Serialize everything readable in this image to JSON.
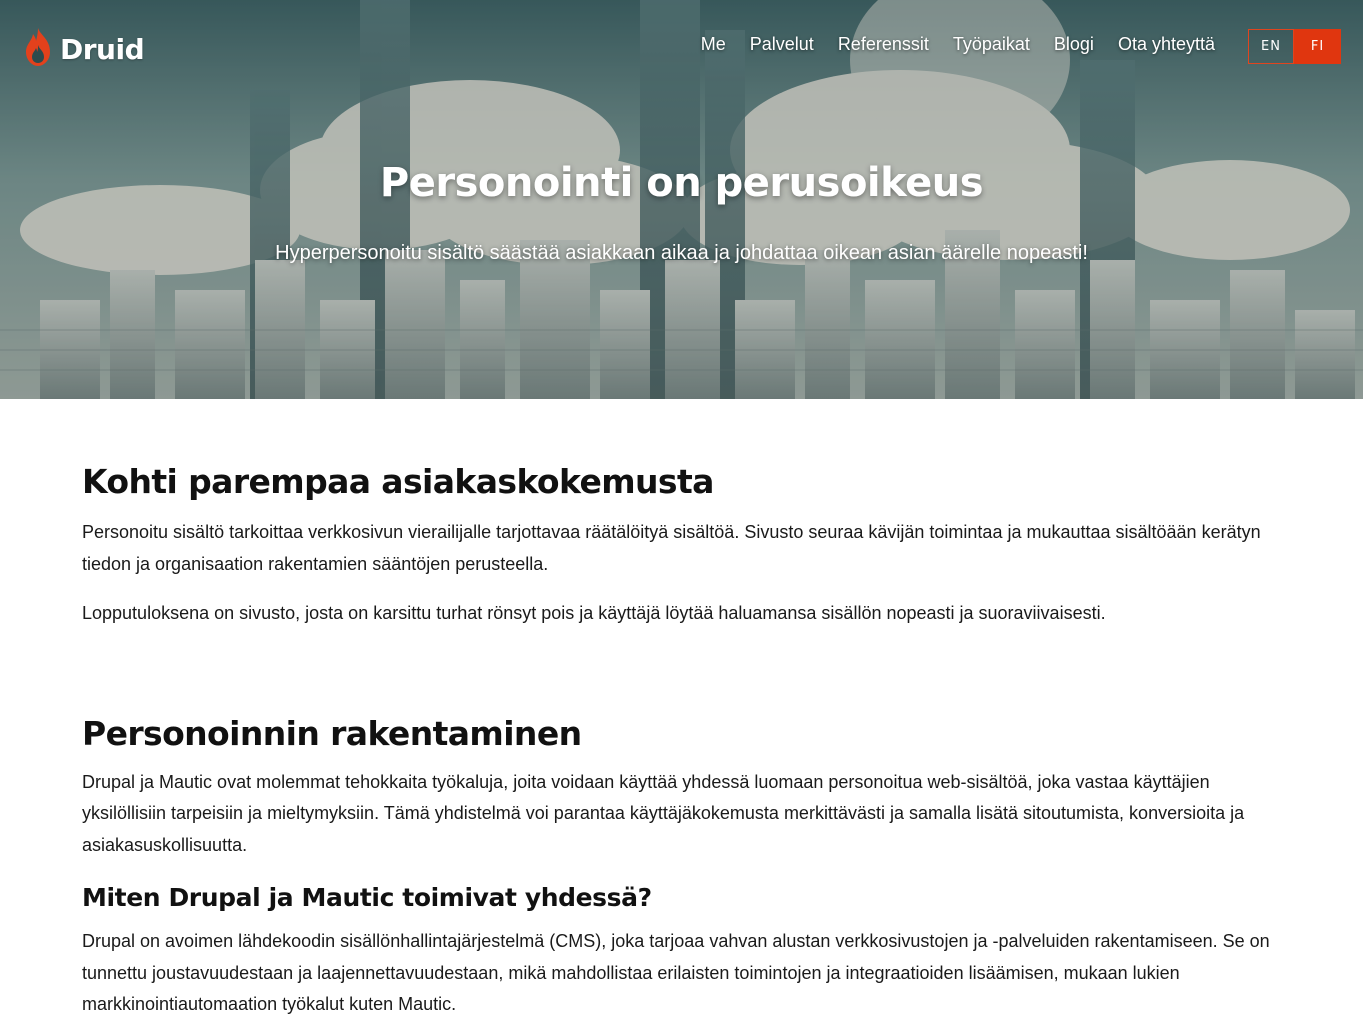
{
  "brand": {
    "name": "Druid",
    "accent": "#e0360f"
  },
  "nav": {
    "items": [
      {
        "label": "Me"
      },
      {
        "label": "Palvelut"
      },
      {
        "label": "Referenssit"
      },
      {
        "label": "Työpaikat"
      },
      {
        "label": "Blogi"
      },
      {
        "label": "Ota yhteyttä"
      }
    ]
  },
  "language": {
    "options": [
      "EN",
      "FI"
    ],
    "selected": "FI"
  },
  "hero": {
    "title": "Personointi on perusoikeus",
    "subtitle": "Hyperpersonoitu sisältö säästää asiakkaan aikaa ja johdattaa oikean asian äärelle nopeasti!"
  },
  "sections": [
    {
      "title": "Kohti parempaa asiakaskokemusta",
      "paragraphs": [
        "Personoitu sisältö tarkoittaa verkkosivun vierailijalle tarjottavaa räätälöityä sisältöä. Sivusto seuraa kävijän toimintaa ja mukauttaa sisältöään kerätyn tiedon ja organisaation rakentamien sääntöjen perusteella.",
        "Lopputuloksena on sivusto, josta on karsittu turhat rönsyt pois ja käyttäjä löytää haluamansa sisällön nopeasti ja suoraviivaisesti."
      ]
    },
    {
      "title": "Personoinnin rakentaminen",
      "paragraphs": [
        "Drupal ja Mautic ovat molemmat tehokkaita työkaluja, joita voidaan käyttää yhdessä luomaan personoitua web-sisältöä, joka vastaa käyttäjien yksilöllisiin tarpeisiin ja mieltymyksiin. Tämä yhdistelmä voi parantaa käyttäjäkokemusta merkittävästi ja samalla lisätä sitoutumista, konversioita ja asiakasuskollisuutta."
      ]
    },
    {
      "title": "Miten Drupal ja Mautic toimivat yhdessä?",
      "paragraphs": [
        "Drupal on avoimen lähdekoodin sisällönhallintajärjestelmä (CMS), joka tarjoaa vahvan alustan verkkosivustojen ja -palveluiden rakentamiseen. Se on tunnettu joustavuudestaan ja laajennettavuudestaan, mikä mahdollistaa erilaisten toimintojen ja integraatioiden lisäämisen, mukaan lukien markkinointiautomaation työkalut kuten Mautic."
      ]
    }
  ],
  "icons": {
    "logo": "flame-icon"
  }
}
